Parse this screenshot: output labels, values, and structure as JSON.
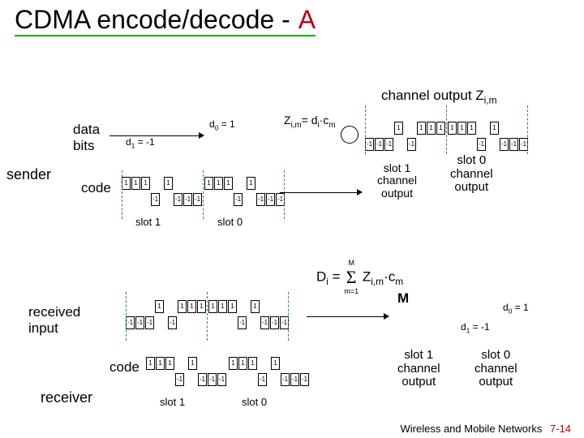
{
  "title_main": "CDMA encode/decode - ",
  "title_accent": "A",
  "labels": {
    "sender": "sender",
    "data_bits_l1": "data",
    "data_bits_l2": "bits",
    "code": "code",
    "received_l1": "received",
    "received_l2": "input",
    "receiver": "receiver",
    "channel_output": "channel output Z",
    "channel_output_sub": "i,m",
    "zim_eq": "Z",
    "zim_sub": "i,m",
    "zim_rhs": "= d",
    "zim_rhs_sub": "i",
    "zim_rhs2": "·c",
    "zim_rhs2_sub": "m",
    "d0": "d",
    "d0_sub": "0",
    "d0_val": " = 1",
    "d1": "d",
    "d1_sub": "1",
    "d1_val": " = -1",
    "slot1": "slot 1",
    "slot0": "slot 0",
    "s1o_l1": "slot 1",
    "s1o_l2": "channel",
    "s1o_l3": "output",
    "s0o_l1": "slot 0",
    "s0o_l2": "channel",
    "s0o_l3": "output",
    "di_eq": "D",
    "di_sub": "i",
    "di_eq2": " = ",
    "sum_upper": "M",
    "sum_lower": "m=1",
    "di_rhs": " Z",
    "di_rhs_sub": "i,m",
    "di_rhs2": "·c",
    "di_rhs2_sub": "m",
    "M": "M"
  },
  "chart_data": {
    "type": "table",
    "description": "CDMA encoding/decoding chip sequences for sender A. Each slot has 8 chips. +1 drawn above baseline, -1 below.",
    "code_sequence": [
      1,
      1,
      1,
      -1,
      1,
      -1,
      -1,
      -1
    ],
    "sender": {
      "data_bits": {
        "d1": -1,
        "d0": 1
      },
      "encoded": {
        "slot1": [
          -1,
          -1,
          -1,
          1,
          -1,
          1,
          1,
          1
        ],
        "slot0": [
          1,
          1,
          1,
          -1,
          1,
          -1,
          -1,
          -1
        ]
      }
    },
    "received_input": {
      "slot1": [
        -1,
        -1,
        -1,
        1,
        -1,
        1,
        1,
        1
      ],
      "slot0": [
        1,
        1,
        1,
        -1,
        1,
        -1,
        -1,
        -1
      ]
    },
    "decoded": {
      "d1": -1,
      "d0": 1
    }
  },
  "footer": {
    "text": "Wireless and Mobile Networks",
    "page": "7-14"
  }
}
